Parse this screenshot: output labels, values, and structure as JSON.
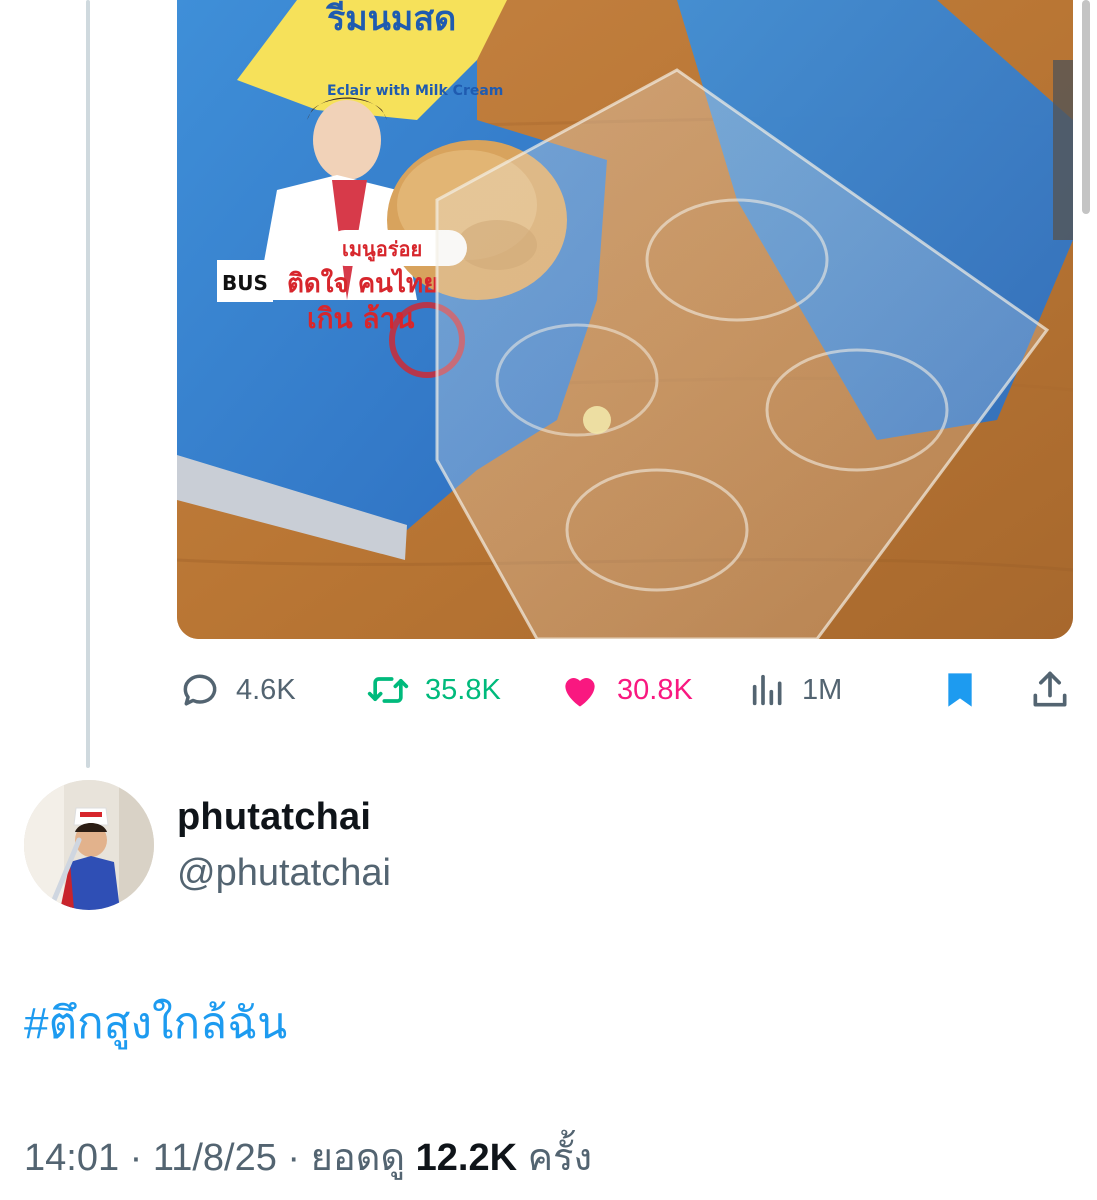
{
  "media": {
    "package_text": {
      "brand_line": "รีมนมสด",
      "product_line": "Eclair with Milk Cream",
      "badge_line1": "เมนูอร่อย",
      "badge_line2": "ติดใจ คนไทย",
      "badge_line3": "เกิน ล้าน",
      "logo_text": "BUS"
    }
  },
  "actions": {
    "reply_count": "4.6K",
    "retweet_count": "35.8K",
    "like_count": "30.8K",
    "views_count": "1M",
    "colors": {
      "reply": "#536471",
      "retweet": "#00ba7c",
      "like": "#f91880",
      "bookmark": "#1d9bf0"
    },
    "icons": [
      "reply-icon",
      "retweet-icon",
      "heart-icon",
      "views-icon",
      "bookmark-icon",
      "share-icon"
    ]
  },
  "reply": {
    "author_name": "phutatchai",
    "author_handle": "@phutatchai",
    "hashtag": "#ตึกสูงใกล้ฉัน",
    "time": "14:01",
    "date": "11/8/25",
    "views_label": "ยอดดู",
    "views_value": "12.2K",
    "views_suffix": "ครั้ง"
  }
}
